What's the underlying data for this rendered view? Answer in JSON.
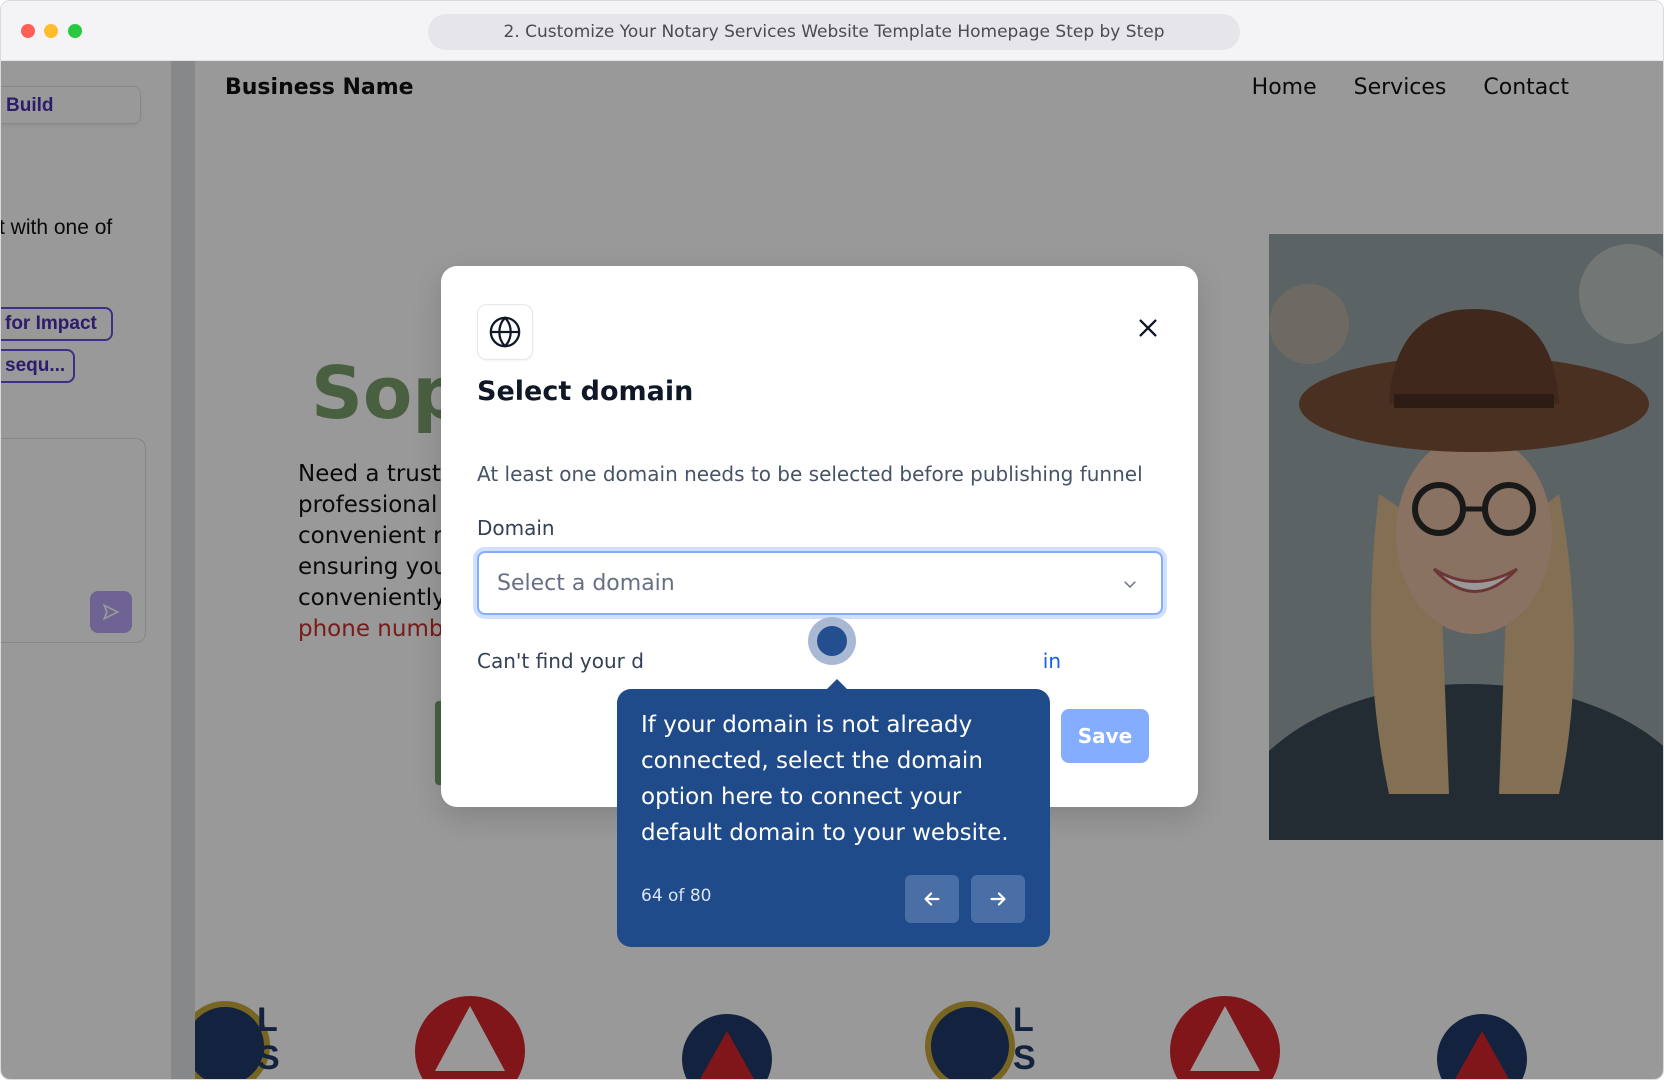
{
  "window": {
    "title": "2. Customize Your Notary Services Website Template Homepage Step by Step"
  },
  "left_panel": {
    "build_label": "Build",
    "text_fragment": "t with one of",
    "chip_1": "for Impact",
    "chip_2": "sequ..."
  },
  "page": {
    "business_name": "Business Name",
    "nav": [
      "Home",
      "Services",
      "Contact"
    ],
    "hero_title": "Sop",
    "hero_lines": [
      "Need a trust",
      "professional",
      "convenient n",
      "ensuring you",
      "conveniently"
    ],
    "hero_red_line": "phone numb"
  },
  "modal": {
    "icon": "globe-icon",
    "title": "Select domain",
    "description": "At least one domain needs to be selected before publishing funnel",
    "domain_label": "Domain",
    "domain_placeholder": "Select a domain",
    "cant_find": "Can't find your d",
    "connect_link": "in",
    "save_label": "Save"
  },
  "tooltip": {
    "text": "If your domain is not already connected, select the domain option here to connect your default domain to your website.",
    "step": "64 of 80"
  },
  "colors": {
    "primary": "#84adff",
    "tooltip_bg": "#1f4b8a",
    "hero_green": "#7ba06b",
    "accent_purple": "#4b2fb3"
  }
}
